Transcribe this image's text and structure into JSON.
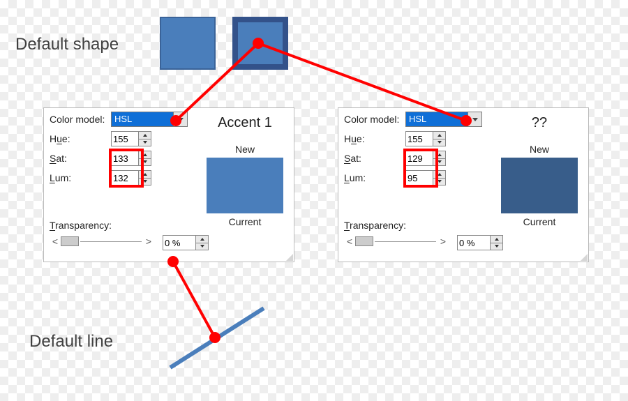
{
  "labels": {
    "default_shape": "Default shape",
    "default_line": "Default line"
  },
  "swatch": {
    "fill_color": "#4a7ebb",
    "outline_fill": "#4a7ebb",
    "outline_border": "#33528a"
  },
  "dialog_left": {
    "color_model_label": "Color model:",
    "color_model_value": "HSL",
    "hue_label": "Hue:",
    "hue_value": "155",
    "sat_label": "Sat:",
    "sat_value": "133",
    "lum_label": "Lum:",
    "lum_value": "132",
    "transparency_label": "Transparency:",
    "transparency_value": "0 %",
    "preview_title": "Accent 1",
    "new_label": "New",
    "current_label": "Current",
    "swatch_color": "#4a7ebb"
  },
  "dialog_right": {
    "color_model_label": "Color model:",
    "color_model_value": "HSL",
    "hue_label": "Hue:",
    "hue_value": "155",
    "sat_label": "Sat:",
    "sat_value": "129",
    "lum_label": "Lum:",
    "lum_value": "95",
    "transparency_label": "Transparency:",
    "transparency_value": "0 %",
    "preview_title": "??",
    "new_label": "New",
    "current_label": "Current",
    "swatch_color": "#385d8a"
  },
  "slider": {
    "left_cap": "<",
    "right_cap": ">"
  },
  "line": {
    "color": "#4a7ebb"
  }
}
